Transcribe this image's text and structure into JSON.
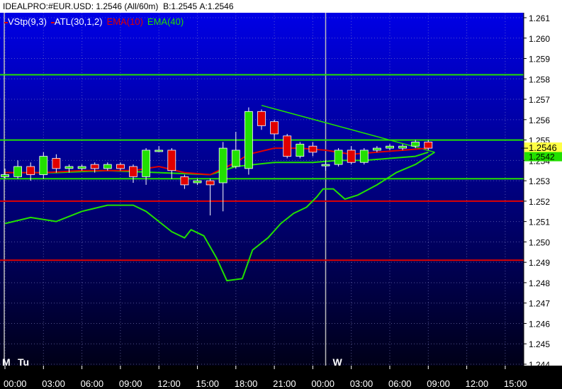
{
  "window": {
    "symbol": "IDEALPRO:#EUR.USD: 1.2546 (All/60m)",
    "bid": "B:1.2545",
    "ask": "A:1.2546"
  },
  "colors": {
    "background_top": "#0000e6",
    "background_bottom": "#000018",
    "candle_up": "#22e000",
    "candle_down": "#e00000",
    "ema10": "#e00000",
    "ema40": "#22e000",
    "atl": "#22e000",
    "hline_green": "#22e000",
    "hline_red": "#e00000",
    "axis_bg": "#ffffff",
    "price_label_bg": "#ffff44"
  },
  "chart_data": {
    "type": "candlestick",
    "legend": [
      {
        "name": "VStp(9,3)",
        "color": "#ffffff"
      },
      {
        "name": "ATL(30,1,2)",
        "color": "#ffffff"
      },
      {
        "name": "EMA(10)",
        "color": "#e00000"
      },
      {
        "name": "EMA(40)",
        "color": "#22e000"
      }
    ],
    "y_ticks": [
      "1.261",
      "1.260",
      "1.259",
      "1.258",
      "1.257",
      "1.256",
      "1.255",
      "1.254",
      "1.253",
      "1.252",
      "1.251",
      "1.250",
      "1.249",
      "1.248",
      "1.247",
      "1.246",
      "1.245",
      "1.244"
    ],
    "ylim": [
      1.244,
      1.2615
    ],
    "x_ticks": [
      "00:00",
      "03:00",
      "06:00",
      "09:00",
      "12:00",
      "15:00",
      "18:00",
      "21:00",
      "00:00",
      "03:00",
      "06:00",
      "09:00",
      "12:00",
      "15:00"
    ],
    "day_labels": [
      {
        "label": "M",
        "hour": 0
      },
      {
        "label": "Tu",
        "hour": 1
      },
      {
        "label": "W",
        "hour": 25
      }
    ],
    "hours_total": 41,
    "current_price": "1.2546",
    "current_price_secondary": "1.2542",
    "horizontal_lines": [
      {
        "price": 1.2582,
        "color": "green"
      },
      {
        "price": 1.255,
        "color": "green"
      },
      {
        "price": 1.2531,
        "color": "green"
      },
      {
        "price": 1.252,
        "color": "red"
      },
      {
        "price": 1.2491,
        "color": "red"
      }
    ],
    "candles": [
      {
        "h": 0,
        "o": 1.2532,
        "c": 1.2533,
        "hi": 1.2536,
        "lo": 1.2531
      },
      {
        "h": 1,
        "o": 1.2532,
        "c": 1.2537,
        "hi": 1.254,
        "lo": 1.2531
      },
      {
        "h": 2,
        "o": 1.2537,
        "c": 1.2533,
        "hi": 1.2539,
        "lo": 1.253
      },
      {
        "h": 3,
        "o": 1.2533,
        "c": 1.2542,
        "hi": 1.2544,
        "lo": 1.2531
      },
      {
        "h": 4,
        "o": 1.2541,
        "c": 1.2536,
        "hi": 1.2543,
        "lo": 1.2534
      },
      {
        "h": 5,
        "o": 1.2536,
        "c": 1.2537,
        "hi": 1.2538,
        "lo": 1.2534
      },
      {
        "h": 6,
        "o": 1.2536,
        "c": 1.2537,
        "hi": 1.2538,
        "lo": 1.2535
      },
      {
        "h": 7,
        "o": 1.2538,
        "c": 1.2536,
        "hi": 1.2539,
        "lo": 1.2534
      },
      {
        "h": 8,
        "o": 1.2536,
        "c": 1.2538,
        "hi": 1.2539,
        "lo": 1.2535
      },
      {
        "h": 9,
        "o": 1.2538,
        "c": 1.2536,
        "hi": 1.2539,
        "lo": 1.2535
      },
      {
        "h": 10,
        "o": 1.2537,
        "c": 1.2532,
        "hi": 1.2538,
        "lo": 1.2529
      },
      {
        "h": 11,
        "o": 1.2532,
        "c": 1.2545,
        "hi": 1.2546,
        "lo": 1.2528
      },
      {
        "h": 12,
        "o": 1.2545,
        "c": 1.2545,
        "hi": 1.2547,
        "lo": 1.2544
      },
      {
        "h": 13,
        "o": 1.2545,
        "c": 1.2535,
        "hi": 1.2546,
        "lo": 1.2531
      },
      {
        "h": 14,
        "o": 1.2532,
        "c": 1.2528,
        "hi": 1.2533,
        "lo": 1.2526
      },
      {
        "h": 15,
        "o": 1.2529,
        "c": 1.253,
        "hi": 1.2531,
        "lo": 1.2528
      },
      {
        "h": 16,
        "o": 1.253,
        "c": 1.2528,
        "hi": 1.2531,
        "lo": 1.2513
      },
      {
        "h": 17,
        "o": 1.2529,
        "c": 1.2546,
        "hi": 1.2549,
        "lo": 1.2515
      },
      {
        "h": 18,
        "o": 1.2537,
        "c": 1.2545,
        "hi": 1.2554,
        "lo": 1.2536
      },
      {
        "h": 19,
        "o": 1.2536,
        "c": 1.2564,
        "hi": 1.2566,
        "lo": 1.2533
      },
      {
        "h": 20,
        "o": 1.2564,
        "c": 1.2557,
        "hi": 1.2565,
        "lo": 1.2555
      },
      {
        "h": 21,
        "o": 1.2559,
        "c": 1.2553,
        "hi": 1.256,
        "lo": 1.255
      },
      {
        "h": 22,
        "o": 1.2552,
        "c": 1.2542,
        "hi": 1.2553,
        "lo": 1.2541
      },
      {
        "h": 23,
        "o": 1.2542,
        "c": 1.2548,
        "hi": 1.2549,
        "lo": 1.2541
      },
      {
        "h": 24,
        "o": 1.2547,
        "c": 1.2544,
        "hi": 1.2549,
        "lo": 1.2542
      },
      {
        "h": 25,
        "o": 1.2538,
        "c": 1.2538,
        "hi": 1.254,
        "lo": 1.2535
      },
      {
        "h": 26,
        "o": 1.2538,
        "c": 1.2545,
        "hi": 1.2546,
        "lo": 1.2537
      },
      {
        "h": 27,
        "o": 1.2545,
        "c": 1.2539,
        "hi": 1.2547,
        "lo": 1.2538
      },
      {
        "h": 28,
        "o": 1.2539,
        "c": 1.2545,
        "hi": 1.2546,
        "lo": 1.2538
      },
      {
        "h": 29,
        "o": 1.2545,
        "c": 1.2546,
        "hi": 1.2547,
        "lo": 1.2544
      },
      {
        "h": 30,
        "o": 1.2546,
        "c": 1.2547,
        "hi": 1.2548,
        "lo": 1.2545
      },
      {
        "h": 31,
        "o": 1.2546,
        "c": 1.2547,
        "hi": 1.2548,
        "lo": 1.2545
      },
      {
        "h": 32,
        "o": 1.2547,
        "c": 1.2549,
        "hi": 1.255,
        "lo": 1.2546
      },
      {
        "h": 33,
        "o": 1.2549,
        "c": 1.2546,
        "hi": 1.255,
        "lo": 1.2545
      }
    ],
    "ema10": [
      [
        0,
        1.2534
      ],
      [
        3,
        1.2534
      ],
      [
        6,
        1.2535
      ],
      [
        8,
        1.2535
      ],
      [
        10,
        1.2535
      ],
      [
        12,
        1.2537
      ],
      [
        14,
        1.2534
      ],
      [
        16,
        1.2533
      ],
      [
        18,
        1.2539
      ],
      [
        19,
        1.2543
      ],
      [
        21,
        1.2546
      ],
      [
        23,
        1.2546
      ],
      [
        25,
        1.2545
      ],
      [
        27,
        1.2543
      ],
      [
        29,
        1.2544
      ],
      [
        31,
        1.2545
      ],
      [
        33,
        1.2546
      ]
    ],
    "ema40": [
      [
        0,
        1.2534
      ],
      [
        4,
        1.2534
      ],
      [
        8,
        1.2535
      ],
      [
        12,
        1.2534
      ],
      [
        16,
        1.2533
      ],
      [
        18,
        1.2537
      ],
      [
        21,
        1.2539
      ],
      [
        24,
        1.2539
      ],
      [
        26,
        1.254
      ],
      [
        28,
        1.254
      ],
      [
        30,
        1.2541
      ],
      [
        32,
        1.2542
      ],
      [
        33,
        1.2544
      ]
    ],
    "vstop": [
      [
        0,
        1.2509
      ],
      [
        2,
        1.2512
      ],
      [
        4,
        1.251
      ],
      [
        6,
        1.2515
      ],
      [
        8,
        1.2518
      ],
      [
        10,
        1.2518
      ],
      [
        11,
        1.2515
      ],
      [
        12,
        1.251
      ],
      [
        13,
        1.2505
      ],
      [
        14,
        1.2502
      ],
      [
        14.5,
        1.2506
      ],
      [
        15.5,
        1.2503
      ],
      [
        16.5,
        1.2492
      ],
      [
        17.3,
        1.2481
      ],
      [
        18.5,
        1.2482
      ],
      [
        19.3,
        1.2496
      ],
      [
        20.5,
        1.2502
      ],
      [
        21.5,
        1.2509
      ],
      [
        22.5,
        1.2514
      ],
      [
        23.5,
        1.2517
      ],
      [
        24.3,
        1.2522
      ],
      [
        24.8,
        1.2526
      ],
      [
        25.6,
        1.2526
      ],
      [
        26.5,
        1.2521
      ],
      [
        27.5,
        1.2523
      ],
      [
        29,
        1.2528
      ],
      [
        30.5,
        1.2534
      ],
      [
        32,
        1.2538
      ],
      [
        33.5,
        1.2544
      ]
    ],
    "atl": [
      [
        20,
        1.2567
      ],
      [
        33.5,
        1.2544
      ]
    ],
    "session_lines": [
      0,
      25
    ]
  }
}
